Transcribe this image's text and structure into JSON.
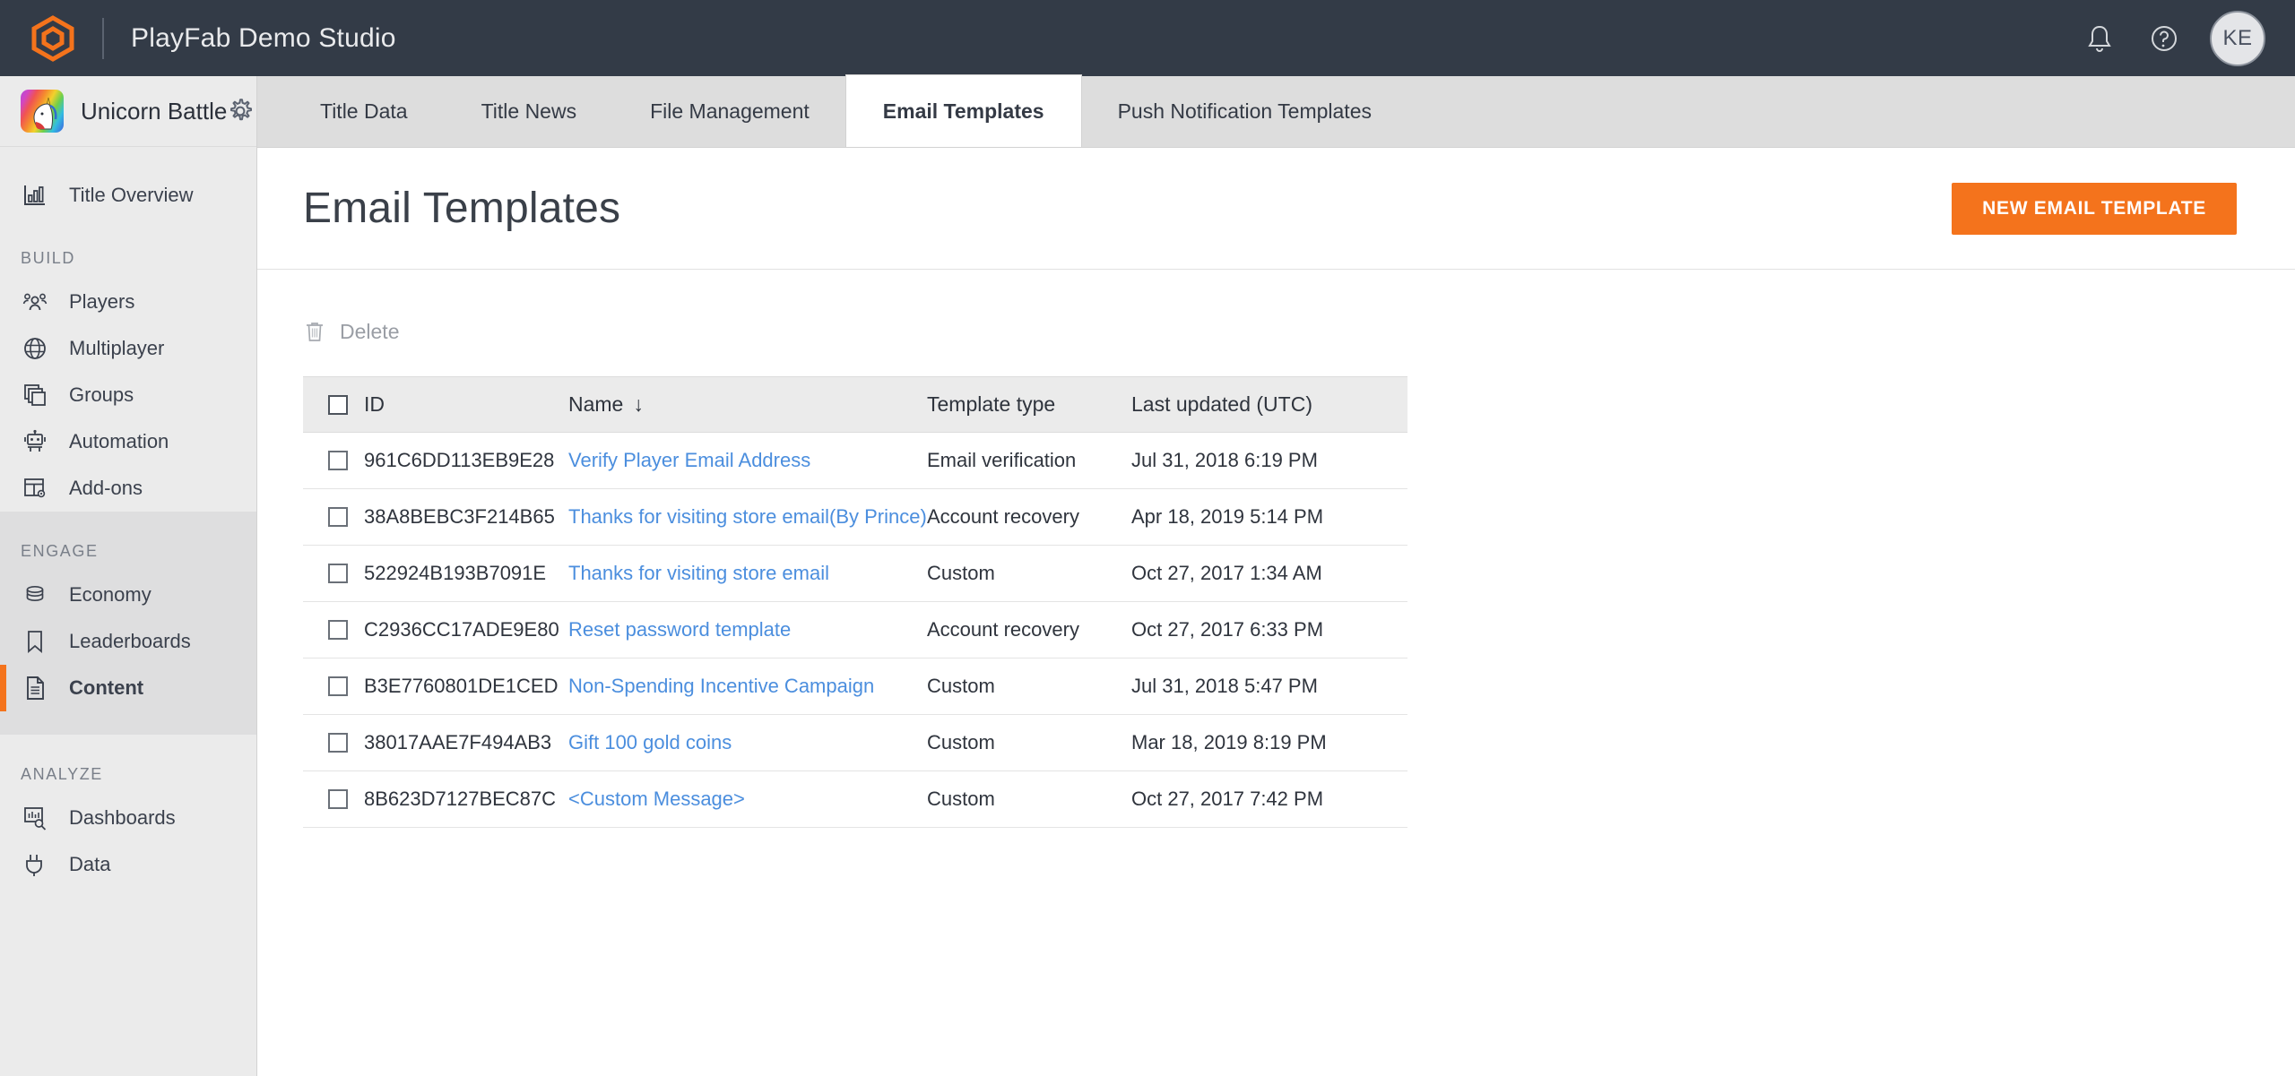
{
  "topbar": {
    "logo_icon": "playfab-hex-logo",
    "studio_name": "PlayFab Demo Studio",
    "bell_icon": "notification-bell-icon",
    "help_icon": "help-circle-icon",
    "avatar_initials": "KE",
    "accent_color": "#f4731c",
    "background_color": "#333b47"
  },
  "sidebar": {
    "title_name": "Unicorn Battle",
    "title_avatar_icon": "unicorn-avatar",
    "settings_icon": "gear-icon",
    "overview": {
      "label": "Title Overview",
      "icon": "bar-chart-icon"
    },
    "groups": [
      {
        "label": "BUILD",
        "items": [
          {
            "label": "Players",
            "icon": "people-icon",
            "active": false
          },
          {
            "label": "Multiplayer",
            "icon": "globe-icon",
            "active": false
          },
          {
            "label": "Groups",
            "icon": "stacked-squares-icon",
            "active": false
          },
          {
            "label": "Automation",
            "icon": "robot-icon",
            "active": false
          },
          {
            "label": "Add-ons",
            "icon": "grid-gear-icon",
            "active": false
          }
        ]
      },
      {
        "label": "ENGAGE",
        "items": [
          {
            "label": "Economy",
            "icon": "coins-stack-icon",
            "active": false
          },
          {
            "label": "Leaderboards",
            "icon": "bookmark-icon",
            "active": false
          },
          {
            "label": "Content",
            "icon": "document-icon",
            "active": true
          }
        ]
      },
      {
        "label": "ANALYZE",
        "items": [
          {
            "label": "Dashboards",
            "icon": "chart-search-icon",
            "active": false
          },
          {
            "label": "Data",
            "icon": "data-plug-icon",
            "active": false
          }
        ]
      }
    ]
  },
  "tabs": [
    {
      "label": "Title Data",
      "active": false
    },
    {
      "label": "Title News",
      "active": false
    },
    {
      "label": "File Management",
      "active": false
    },
    {
      "label": "Email Templates",
      "active": true
    },
    {
      "label": "Push Notification Templates",
      "active": false
    }
  ],
  "page": {
    "title": "Email Templates",
    "new_button_label": "NEW EMAIL TEMPLATE"
  },
  "toolbar": {
    "delete_label": "Delete",
    "delete_icon": "trash-icon"
  },
  "table": {
    "columns": [
      "ID",
      "Name",
      "Template type",
      "Last updated (UTC)"
    ],
    "sort_column": "Name",
    "sort_indicator": "↓",
    "header_checkbox_checked": false,
    "rows": [
      {
        "checked": false,
        "id": "961C6DD113EB9E28",
        "name": "Verify Player Email Address",
        "type": "Email verification",
        "updated": "Jul 31, 2018 6:19 PM"
      },
      {
        "checked": false,
        "id": "38A8BEBC3F214B65",
        "name": "Thanks for visiting store email(By Prince)",
        "type": "Account recovery",
        "updated": "Apr 18, 2019 5:14 PM"
      },
      {
        "checked": false,
        "id": "522924B193B7091E",
        "name": "Thanks for visiting store email",
        "type": "Custom",
        "updated": "Oct 27, 2017 1:34 AM"
      },
      {
        "checked": false,
        "id": "C2936CC17ADE9E80",
        "name": "Reset password template",
        "type": "Account recovery",
        "updated": "Oct 27, 2017 6:33 PM"
      },
      {
        "checked": false,
        "id": "B3E7760801DE1CED",
        "name": "Non-Spending Incentive Campaign",
        "type": "Custom",
        "updated": "Jul 31, 2018 5:47 PM"
      },
      {
        "checked": false,
        "id": "38017AAE7F494AB3",
        "name": "Gift 100 gold coins",
        "type": "Custom",
        "updated": "Mar 18, 2019 8:19 PM"
      },
      {
        "checked": false,
        "id": "8B623D7127BEC87C",
        "name": "<Custom Message>",
        "type": "Custom",
        "updated": "Oct 27, 2017 7:42 PM"
      }
    ]
  },
  "colors": {
    "accent_orange": "#f4731c",
    "link_blue": "#4b8ede",
    "topbar_dark": "#333b47",
    "sidebar_grey": "#ebebeb"
  }
}
